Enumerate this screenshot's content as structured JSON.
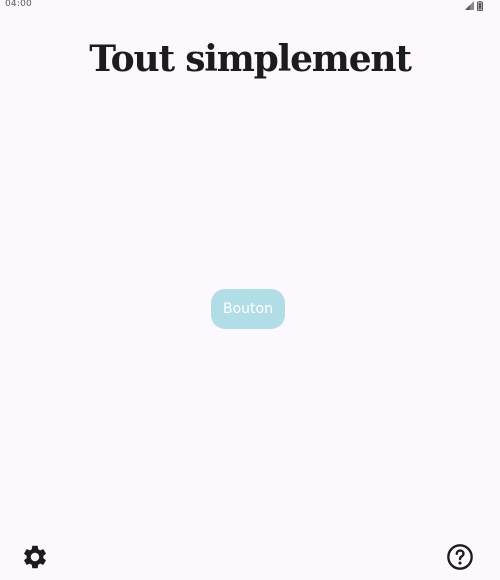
{
  "status_bar": {
    "time": "04:00",
    "icons": [
      "signal-icon",
      "battery-icon"
    ]
  },
  "header": {
    "title": "Tout simplement"
  },
  "main": {
    "button_label": "Bouton",
    "button_color": "#b0dde6"
  },
  "footer": {
    "left_icon": "settings-icon",
    "right_icon": "help-icon"
  },
  "colors": {
    "background": "#fcf8fd",
    "text": "#1c1b1f"
  }
}
